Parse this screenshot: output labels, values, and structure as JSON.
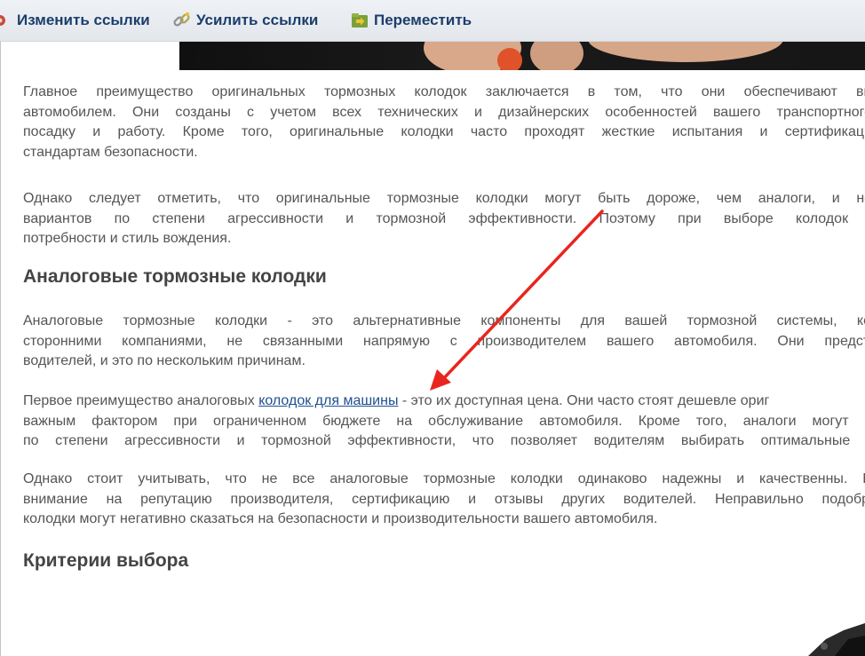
{
  "toolbar": {
    "edit_label": "Изменить ссылки",
    "boost_label": "Усилить ссылки",
    "move_label": "Переместить"
  },
  "article": {
    "p1": [
      "Главное преимущество оригинальных тормозных колодок заключается в том, что они обеспечивают высокий",
      "автомобилем. Они созданы с учетом всех технических и дизайнерских особенностей вашего транспортного сре",
      "посадку и работу. Кроме того, оригинальные колодки часто проходят жесткие испытания и сертификацию, ч",
      "стандартам безопасности."
    ],
    "p2": [
      "Однако следует отметить, что оригинальные тормозные колодки могут быть дороже, чем аналоги, и не все",
      "вариантов по степени агрессивности и тормозной эффективности. Поэтому при выборе колодок важно",
      "потребности и стиль вождения."
    ],
    "h2_analog": "Аналоговые тормозные колодки",
    "p3": [
      "Аналоговые тормозные колодки - это альтернативные компоненты для вашей тормозной системы, которые",
      "сторонними компаниями, не связанными напрямую с производителем вашего автомобиля. Они представляю",
      "водителей, и это по нескольким причинам."
    ],
    "p4_line1_before": "Первое преимущество аналоговых ",
    "p4_link": "колодок для машины",
    "p4_line1_after": " - это их доступная цена. Они часто стоят дешевле ориг",
    "p4_rest": [
      "важным фактором при ограниченном бюджете на обслуживание автомобиля. Кроме того, аналоги могут предос",
      "по степени агрессивности и тормозной эффективности, что позволяет водителям выбирать оптимальные колодк"
    ],
    "p5": [
      "Однако стоит учитывать, что не все аналоговые тормозные колодки одинаково надежны и качественны. При в",
      "внимание на репутацию производителя, сертификацию и отзывы других водителей. Неправильно подобранные",
      "колодки могут негативно сказаться на безопасности и производительности вашего автомобиля."
    ],
    "h2_criteria": "Критерии выбора"
  },
  "colors": {
    "arrow": "#e8261f",
    "link": "#1f4f8f",
    "text": "#555555",
    "toolbar_text": "#1b3e6b"
  },
  "icons": {
    "edit": "link-edit-icon",
    "boost": "chain-link-icon",
    "move": "folder-move-icon"
  }
}
